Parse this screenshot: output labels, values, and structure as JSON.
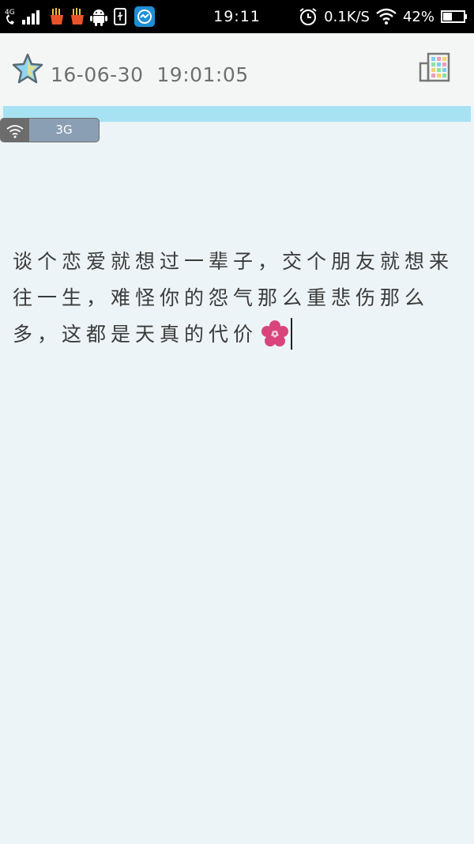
{
  "status_bar": {
    "network_type": "4G",
    "time": "19:11",
    "net_speed": "0.1K/S",
    "battery": "42%"
  },
  "header": {
    "date": "16-06-30",
    "time": "19:01:05"
  },
  "network_badge": {
    "label": "3G"
  },
  "note": {
    "text": "谈个恋爱就想过一辈子，交个朋友就想来往一生，难怪你的怨气那么重悲伤那么多，这都是天真的代价"
  },
  "colors": {
    "accent_strip": "#a7e2f3",
    "flower": "#d9457a"
  },
  "icons": [
    "call-signal-icon",
    "fries-icon",
    "android-icon",
    "usb-icon",
    "app-sync-icon",
    "alarm-icon",
    "wifi-icon",
    "battery-icon",
    "star-icon",
    "skin-grid-icon",
    "flower-icon"
  ]
}
